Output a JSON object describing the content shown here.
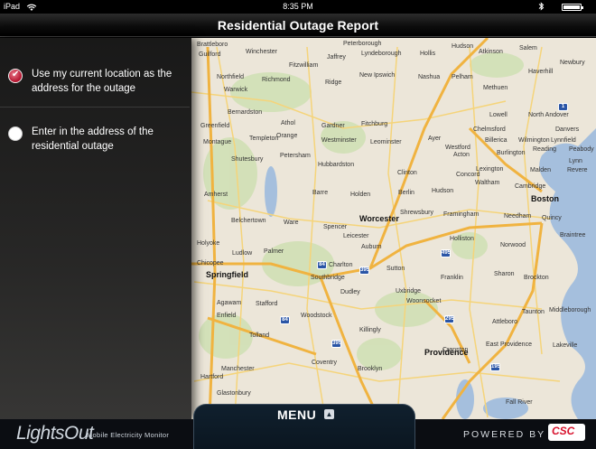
{
  "status_bar": {
    "device": "iPad",
    "time": "8:35 PM",
    "icons": [
      "wifi-icon",
      "bluetooth-icon",
      "battery-icon"
    ],
    "battery_level": 0.95
  },
  "header": {
    "title": "Residential Outage Report"
  },
  "options": [
    {
      "label": "Use my current location as the address for the outage",
      "selected": true
    },
    {
      "label": "Enter in the address of the residential outage",
      "selected": false
    }
  ],
  "map": {
    "cities": [
      "Boston",
      "Worcester",
      "Springfield",
      "Providence"
    ],
    "towns": [
      "Brattleboro",
      "Guilford",
      "Winchester",
      "Fitzwilliam",
      "Jaffrey",
      "Peterborough",
      "Lyndeborough",
      "Hollis",
      "Hudson",
      "Salem",
      "Atkinson",
      "Haverhill",
      "Newbury",
      "Northfield",
      "Warwick",
      "Richmond",
      "Ridge",
      "New Ipswich",
      "Nashua",
      "Pelham",
      "Methuen",
      "Bernardston",
      "Orange",
      "Gardner",
      "Fitchburg",
      "Lowell",
      "North Andover",
      "Danvers",
      "Greenfield",
      "Athol",
      "Westminster",
      "Leominster",
      "Chelmsford",
      "Billerica",
      "Wilmington",
      "Reading",
      "Peabody",
      "Montague",
      "Templeton",
      "Ayer",
      "Westford",
      "Acton",
      "Burlington",
      "Lynnfield",
      "Lynn",
      "Shutesbury",
      "Petersham",
      "Hubbardston",
      "Clinton",
      "Concord",
      "Lexington",
      "Malden",
      "Revere",
      "Amherst",
      "Barre",
      "Holden",
      "Berlin",
      "Hudson",
      "Waltham",
      "Cambridge",
      "Belchertown",
      "Ware",
      "Spencer",
      "Shrewsbury",
      "Framingham",
      "Needham",
      "Quincy",
      "Holyoke",
      "Palmer",
      "Leicester",
      "Auburn",
      "Holliston",
      "Norwood",
      "Braintree",
      "Chicopee",
      "Ludlow",
      "Charlton",
      "Sutton",
      "Franklin",
      "Sharon",
      "Brockton",
      "Southbridge",
      "Dudley",
      "Uxbridge",
      "Woonsocket",
      "Attleboro",
      "Taunton",
      "Agawam",
      "Stafford",
      "Woodstock",
      "Killingly",
      "Cranston",
      "East Providence",
      "Enfield",
      "Tolland",
      "Manchester",
      "Hartford",
      "Glastonbury",
      "Coventry",
      "Brooklyn",
      "Warwick",
      "Middleborough",
      "Lakeville",
      "Fall River"
    ]
  },
  "footer": {
    "brand": "LightsOut",
    "brand_sub": "Mobile Electricity Monitor",
    "menu_label": "MENU",
    "powered_by": "POWERED BY",
    "sponsor_logo": "CSC"
  }
}
